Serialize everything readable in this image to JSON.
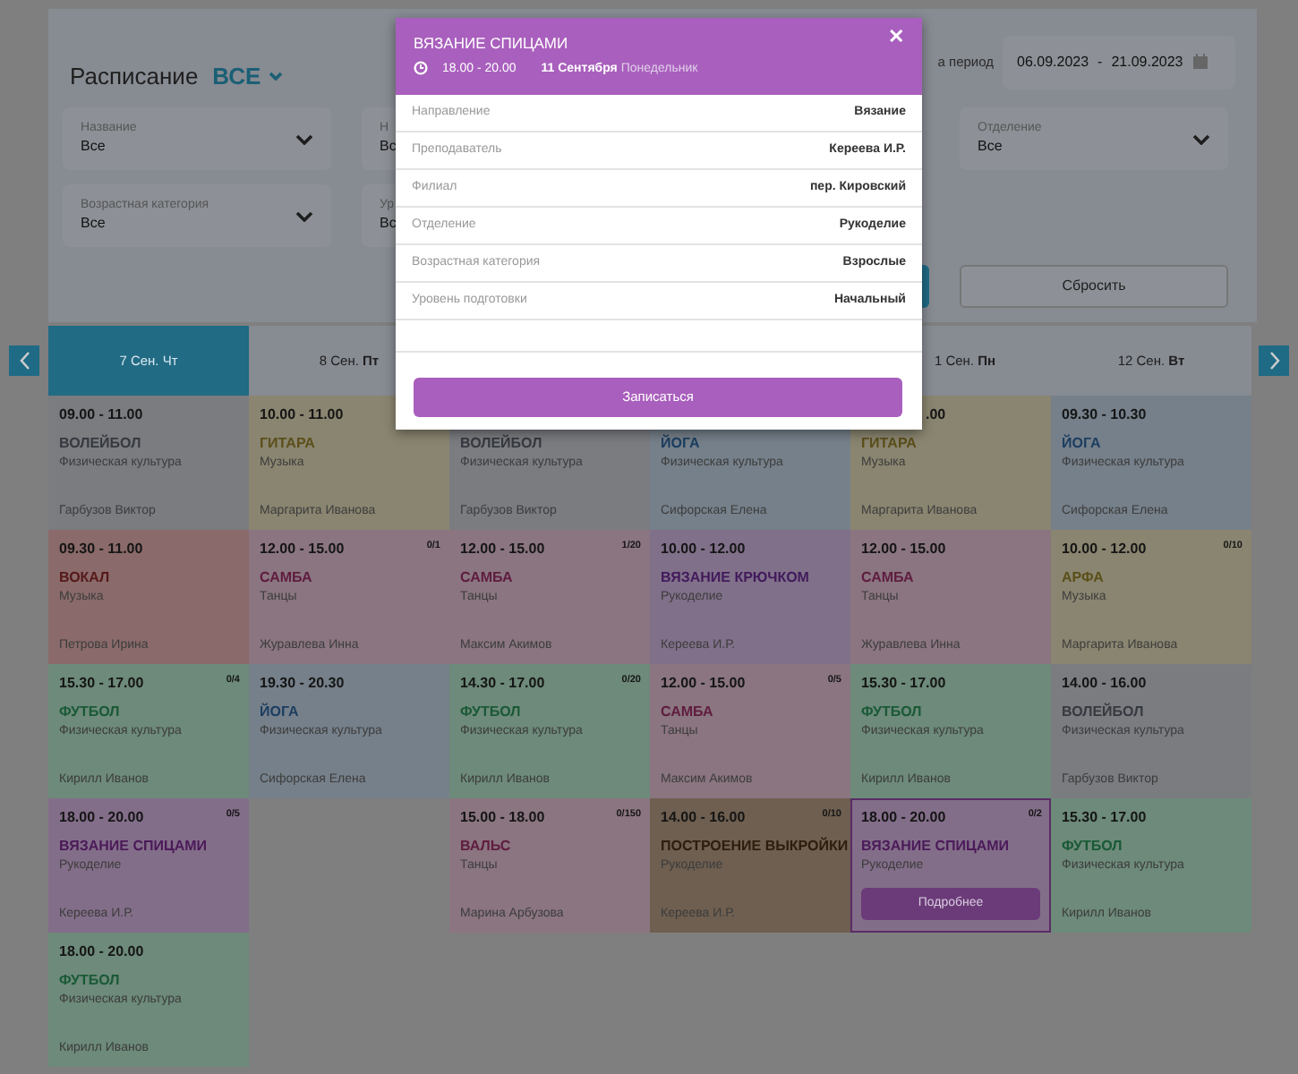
{
  "header": {
    "title": "Расписание",
    "filter_value": "ВСЕ",
    "period_label": "а период",
    "date_from": "06.09.2023",
    "date_separator": "-",
    "date_to": "21.09.2023"
  },
  "filters": [
    {
      "label": "Название",
      "value": "Все"
    },
    {
      "label": "Н",
      "value": "Вс"
    },
    {
      "label": "Отделение",
      "value": "Все"
    },
    {
      "label": "Возрастная категория",
      "value": "Все"
    },
    {
      "label": "Ур",
      "value": "Вс"
    }
  ],
  "reset_button": "Сбросить",
  "days": [
    {
      "date": "7 Сен.",
      "weekday": "Чт",
      "selected": true,
      "events": [
        {
          "time": "09.00 - 11.00",
          "title": "ВОЛЕЙБОЛ",
          "category": "Физическая культура",
          "teacher": "Гарбузов Виктор",
          "color": "#7a7c80"
        },
        {
          "time": "09.30 - 11.00",
          "title": "ВОКАЛ",
          "category": "Музыка",
          "teacher": "Петрова Ирина",
          "color": "#8a6a6a"
        },
        {
          "time": "15.30 - 17.00",
          "capacity": "0/4",
          "title": "ФУТБОЛ",
          "category": "Физическая культура",
          "teacher": "Кирилл Иванов",
          "color": "#6d8a7a"
        },
        {
          "time": "18.00 - 20.00",
          "capacity": "0/5",
          "title": "ВЯЗАНИЕ СПИЦАМИ",
          "category": "Рукоделие",
          "teacher": "Кереева И.Р.",
          "color": "#836e89"
        },
        {
          "time": "18.00 - 20.00",
          "title": "ФУТБОЛ",
          "category": "Физическая культура",
          "teacher": "Кирилл Иванов",
          "color": "#6d8a7a"
        }
      ]
    },
    {
      "date": "8 Сен.",
      "weekday": "Пт",
      "selected": false,
      "events": [
        {
          "time": "10.00 - 11.00",
          "title": "ГИТАРА",
          "category": "Музыка",
          "teacher": "Маргарита Иванова",
          "color": "#8a8570"
        },
        {
          "time": "12.00 - 15.00",
          "capacity": "0/1",
          "title": "САМБА",
          "category": "Танцы",
          "teacher": "Журавлева Инна",
          "color": "#8a7580"
        },
        {
          "time": "19.30 - 20.30",
          "title": "ЙОГА",
          "category": "Физическая культура",
          "teacher": "Сифорская Елена",
          "color": "#76808a"
        }
      ]
    },
    {
      "events": [
        {
          "title": "ВОЛЕЙБОЛ",
          "category": "Физическая культура",
          "teacher": "Гарбузов Виктор",
          "color": "#7a7c80"
        },
        {
          "time": "12.00 - 15.00",
          "capacity": "1/20",
          "title": "САМБА",
          "category": "Танцы",
          "teacher": "Максим Акимов",
          "color": "#8a7580"
        },
        {
          "time": "14.30 - 17.00",
          "capacity": "0/20",
          "title": "ФУТБОЛ",
          "category": "Физическая культура",
          "teacher": "Кирилл Иванов",
          "color": "#6d8a7a"
        },
        {
          "time": "15.00 - 18.00",
          "capacity": "0/150",
          "title": "ВАЛЬС",
          "category": "Танцы",
          "teacher": "Марина Арбузова",
          "color": "#8a7580"
        }
      ]
    },
    {
      "events": [
        {
          "title": "ЙОГА",
          "category": "Физическая культура",
          "teacher": "Сифорская Елена",
          "color": "#76808a"
        },
        {
          "time": "10.00 - 12.00",
          "title": "ВЯЗАНИЕ КРЮЧКОМ",
          "category": "Рукоделие",
          "teacher": "Кереева И.Р.",
          "color": "#80708a"
        },
        {
          "time": "12.00 - 15.00",
          "capacity": "0/5",
          "title": "САМБА",
          "category": "Танцы",
          "teacher": "Максим Акимов",
          "color": "#8a7580"
        },
        {
          "time": "14.00 - 16.00",
          "capacity": "0/10",
          "title": "ПОСТРОЕНИЕ ВЫКРОЙКИ",
          "category": "Рукоделие",
          "teacher": "Кереева И.Р.",
          "color": "#6e5f50"
        }
      ]
    },
    {
      "date": "1 Сен.",
      "weekday": "Пн",
      "selected": false,
      "events": [
        {
          "time": ".00",
          "title": "ГИТАРА",
          "category": "Музыка",
          "teacher": "Маргарита Иванова",
          "color": "#8a8570"
        },
        {
          "time": "12.00 - 15.00",
          "title": "САМБА",
          "category": "Танцы",
          "teacher": "Журавлева Инна",
          "color": "#8a7580"
        },
        {
          "time": "15.30 - 17.00",
          "title": "ФУТБОЛ",
          "category": "Физическая культура",
          "teacher": "Кирилл Иванов",
          "color": "#6d8a7a"
        },
        {
          "time": "18.00 - 20.00",
          "capacity": "0/2",
          "title": "ВЯЗАНИЕ СПИЦАМИ",
          "category": "Рукоделие",
          "details_button": "Подробнее",
          "hovered": true,
          "color": "#836e89"
        }
      ]
    },
    {
      "date": "12 Сен.",
      "weekday": "Вт",
      "selected": false,
      "events": [
        {
          "time": "09.30 - 10.30",
          "title": "ЙОГА",
          "category": "Физическая культура",
          "teacher": "Сифорская Елена",
          "color": "#76808a"
        },
        {
          "time": "10.00 - 12.00",
          "capacity": "0/10",
          "title": "АРФА",
          "category": "Музыка",
          "teacher": "Маргарита Иванова",
          "color": "#8a8570"
        },
        {
          "time": "14.00 - 16.00",
          "title": "ВОЛЕЙБОЛ",
          "category": "Физическая культура",
          "teacher": "Гарбузов Виктор",
          "color": "#7a7c80"
        },
        {
          "time": "15.30 - 17.00",
          "title": "ФУТБОЛ",
          "category": "Физическая культура",
          "teacher": "Кирилл Иванов",
          "color": "#6d8a7a"
        }
      ]
    }
  ],
  "modal": {
    "title": "ВЯЗАНИЕ СПИЦАМИ",
    "close": "✕",
    "time": "18.00  -  20.00",
    "date": "11 Сентября",
    "weekday": "Понедельник",
    "rows": [
      {
        "label": "Направление",
        "value": "Вязание"
      },
      {
        "label": "Преподаватель",
        "value": "Кереева И.Р."
      },
      {
        "label": "Филиал",
        "value": "пер. Кировский"
      },
      {
        "label": "Отделение",
        "value": "Рукоделие"
      },
      {
        "label": "Возрастная категория",
        "value": "Взрослые"
      },
      {
        "label": "Уровень подготовки",
        "value": "Начальный"
      }
    ],
    "button": "Записаться"
  }
}
